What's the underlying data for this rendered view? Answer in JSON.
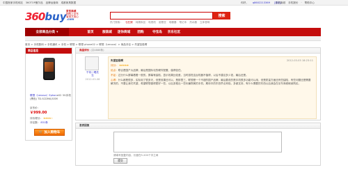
{
  "colors": {
    "brand_red": "#c40d0d",
    "link_blue": "#3333cc",
    "cart_orange": "#f06a00",
    "review_bg": "#fff8ea"
  },
  "topbar": {
    "left_links": [
      "中国首家手机网站",
      "360TOP傲尔品",
      "品牌运营商",
      "成都家具数据"
    ],
    "right_links": [
      "你好，",
      "q8602213369",
      "[退出]"
    ],
    "right2_links": [
      "手机商城",
      "手机报价",
      "·",
      "帮助中心"
    ]
  },
  "header": {
    "logo_part1": "360",
    "logo_part2": "buy",
    "logo_suffix": ".com",
    "slogan_line1": "京东商城",
    "slogan_line2": "网购上京东",
    "slogan_line3": "省钱又放心",
    "search_value": "",
    "search_placeholder": "",
    "search_button": "搜索",
    "hotwords_label": "热门搜索：",
    "hotwords": [
      "七匹狼",
      "纯棉床品",
      "电视机",
      "诺基亚",
      "电暖器",
      "笔记本",
      "热水器",
      "立体音响"
    ]
  },
  "nav": {
    "category_label": "全部商品分类",
    "items": [
      "首页",
      "服装城",
      "迷你商城",
      "团购",
      "夺宝岛",
      "京东社区"
    ]
  },
  "breadcrumb": "首页 > 手机数码 > 手机通讯 > 手机 > 联想 > 联想 phone02 > 联想（Lenovo）> 商品评论 > 失望至极啊",
  "product": {
    "panel_title": "商品信息",
    "name_part1": "联想（Lenovo）Ephon",
    "name_part2": "e02 3G手机 (黑色) TD-SCDMA/GSM",
    "price_label": "京东价：",
    "price": "￥999.00",
    "rating_label": "评价得分：",
    "stars": "★★★★☆",
    "review_count_label": "评论数：",
    "review_count": "831条",
    "cart_button": "加入购物车"
  },
  "reviews": {
    "panel_title": "商品评价",
    "panel_count": "(共4888条)",
    "user_name": "千钧一喝先生（金牌会员）",
    "user_name_short": "千钧一喝先",
    "user_level": "生",
    "user_date": "2012-03-08",
    "title": "失望至极啊",
    "time": "2012-03-03 18:23:11",
    "rating_label": "评分：",
    "rating_stars": "★★★★★",
    "pros_label": "优点：",
    "pros_text": "联合是国产大品牌，最后是国际化的硬件配置，值得信任。",
    "cons_label": "不足：",
    "cons_text": "过分什么屏幕看着一般的，屏幕有缺陷，显示效果比较差，当时感觉这台机器不值得，以后不建议多少钱，最后还是。",
    "summary_label": "心得：",
    "summary_text": "什么都是很多，实际用了很多天，但是效果还可以，是那里三，联想是一个不错的国产品牌，最后要说的是手机很多功能可以用，但是质量方面还有些缺陷，有些问题还是需要解决的，不要让我们失望，希望联想做得更好一些，以后多推出一些价廉物美的手机，期待中的东西早点来临，多谢支持，有什么需要的东西以后我会在京东商城继续购买。"
  },
  "reply": {
    "panel_title": "发表回复",
    "textarea_value": "",
    "hint": "请填写回复内容，长度在5-200个字之间",
    "submit_button": "提交"
  }
}
